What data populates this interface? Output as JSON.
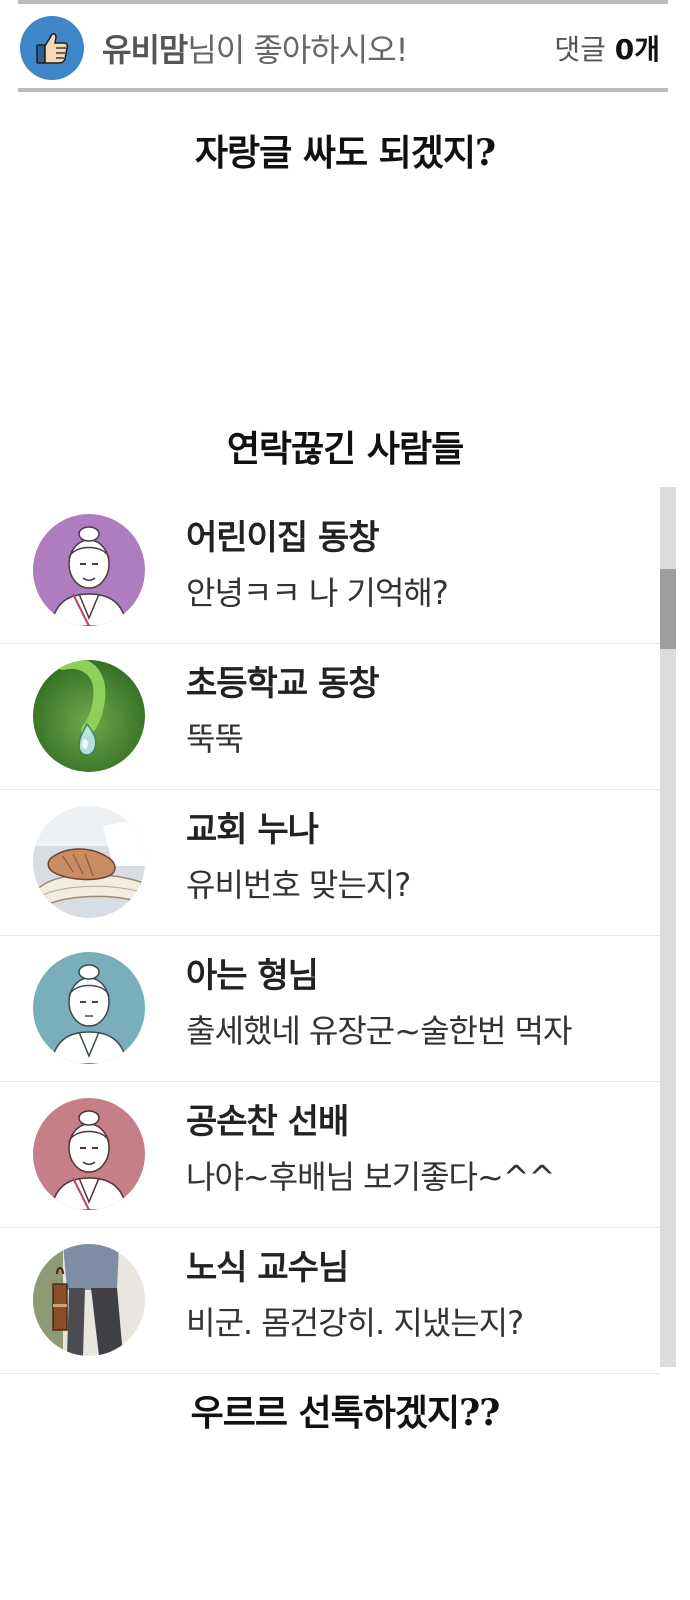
{
  "like_bar": {
    "icon": "thumbs-up-icon",
    "nickname": "유비맘",
    "text": "님이 좋아하시오!",
    "comment_label": "댓글",
    "comment_count": "0개",
    "colors": {
      "icon_bg": "#3f86c9",
      "rule": "#bdbdbd"
    }
  },
  "sections": {
    "boast_title": "자랑글 싸도 되겠지?",
    "lost_contacts_title": "연락끊긴 사람들",
    "footer_title": "우르르 선톡하겠지??"
  },
  "contacts": [
    {
      "name": "어린이집 동창",
      "message": "안녕ㅋㅋ 나 기억해?",
      "avatar": "person-avatar-purple"
    },
    {
      "name": "초등학교 동창",
      "message": "뚝뚝",
      "avatar": "water-drop-leaf-photo"
    },
    {
      "name": "교회 누나",
      "message": "유비번호 맞는지?",
      "avatar": "praying-hands-bible-photo"
    },
    {
      "name": "아는 형님",
      "message": "출세했네 유장군~술한번 먹자",
      "avatar": "person-avatar-teal"
    },
    {
      "name": "공손찬 선배",
      "message": "나야~후배님 보기좋다~^^",
      "avatar": "person-avatar-rose"
    },
    {
      "name": "노식 교수님",
      "message": "비군. 몸건강히. 지냈는지?",
      "avatar": "walking-professor-photo"
    }
  ]
}
